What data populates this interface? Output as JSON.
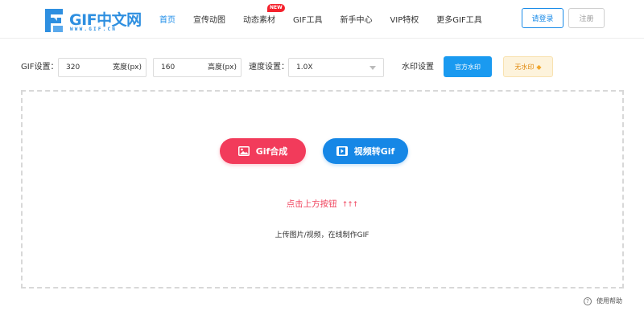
{
  "header": {
    "logo": {
      "title": "GIF中文网",
      "subtitle": "WWW.GIF.CN"
    },
    "nav": [
      {
        "label": "首页",
        "active": true
      },
      {
        "label": "宣传动图",
        "active": false
      },
      {
        "label": "动态素材",
        "active": false,
        "badge": "NEW"
      },
      {
        "label": "GIF工具",
        "active": false
      },
      {
        "label": "新手中心",
        "active": false
      },
      {
        "label": "VIP特权",
        "active": false
      },
      {
        "label": "更多GIF工具",
        "active": false
      }
    ],
    "login_label": "请登录",
    "register_label": "注册"
  },
  "settings": {
    "gif_label": "GIF设置：",
    "width": {
      "value": "320",
      "unit": "宽度(px)"
    },
    "height": {
      "value": "160",
      "unit": "高度(px)"
    },
    "speed_label": "速度设置：",
    "speed_value": "1.0X",
    "watermark_label": "水印设置",
    "official_watermark": "官方水印",
    "no_watermark": "无水印"
  },
  "upload": {
    "merge_button": "Gif合成",
    "video_button": "视频转Gif",
    "hint": "点击上方按钮",
    "hint_arrows": "↑↑↑",
    "description": "上传图片/视频，在线制作GIF"
  },
  "footer": {
    "help_label": "使用帮助",
    "help_icon": "?"
  },
  "colors": {
    "brand_blue": "#1a8be8",
    "merge_red": "#f23b5b",
    "video_blue": "#1687e6",
    "hint_red": "#f0445e",
    "vip_gold": "#e08a10"
  }
}
